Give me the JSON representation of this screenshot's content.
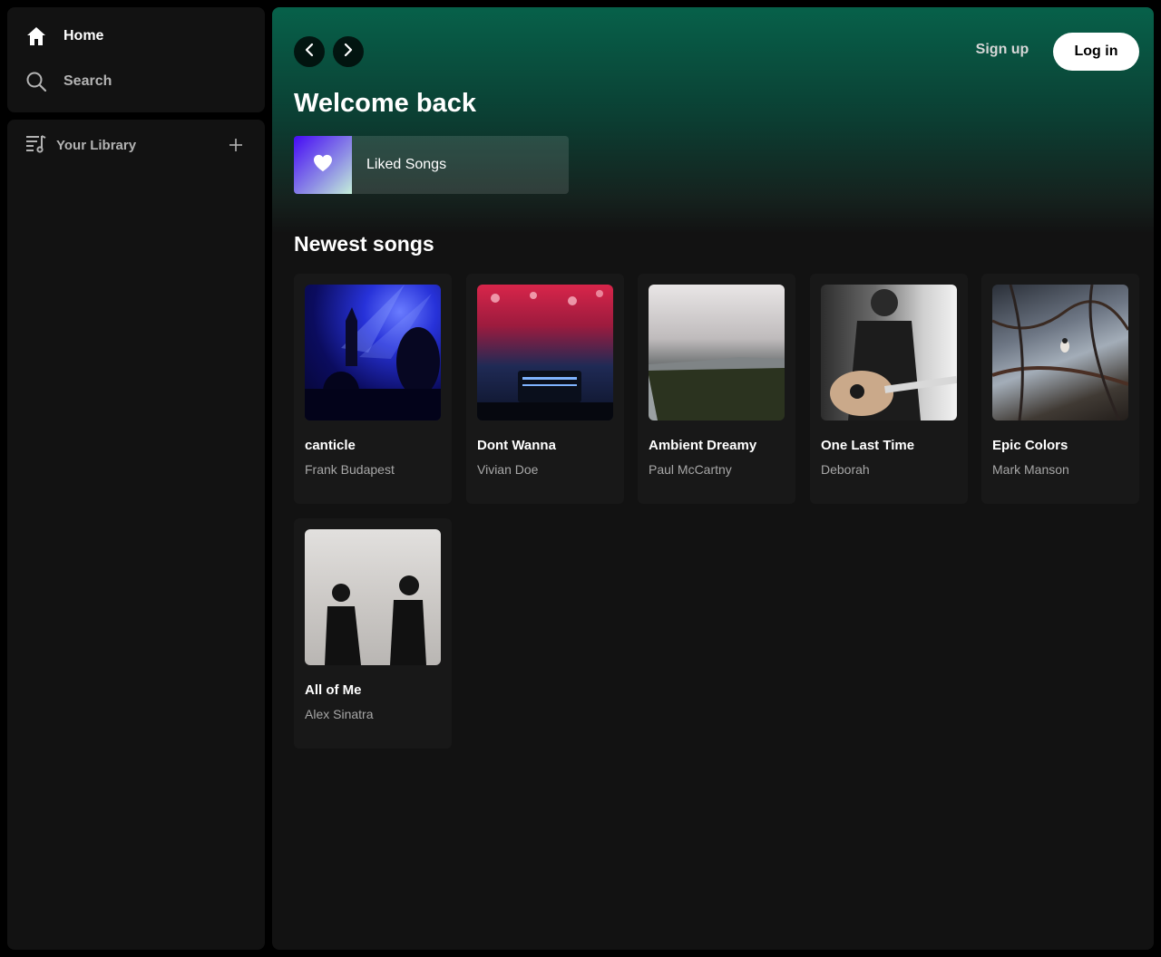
{
  "sidebar": {
    "home_label": "Home",
    "search_label": "Search",
    "library_label": "Your Library",
    "icons": [
      "home-icon",
      "search-icon",
      "library-icon",
      "plus-icon"
    ]
  },
  "header": {
    "signup_label": "Sign up",
    "login_label": "Log in",
    "icons": [
      "chevron-left-icon",
      "chevron-right-icon"
    ]
  },
  "main": {
    "welcome_title": "Welcome back",
    "liked_songs_label": "Liked Songs",
    "section_title": "Newest songs",
    "songs": [
      {
        "title": "canticle",
        "artist": "Frank Budapest"
      },
      {
        "title": "Dont Wanna",
        "artist": "Vivian Doe"
      },
      {
        "title": "Ambient Dreamy",
        "artist": "Paul McCartny"
      },
      {
        "title": "One Last Time",
        "artist": "Deborah"
      },
      {
        "title": "Epic Colors",
        "artist": "Mark Manson"
      },
      {
        "title": "All of Me",
        "artist": "Alex Sinatra"
      }
    ]
  },
  "colors": {
    "background": "#000000",
    "panel": "#121212",
    "card": "#181818",
    "header_gradient_top": "#07614a",
    "muted_text": "#a7a7a7",
    "login_bg": "#ffffff"
  }
}
